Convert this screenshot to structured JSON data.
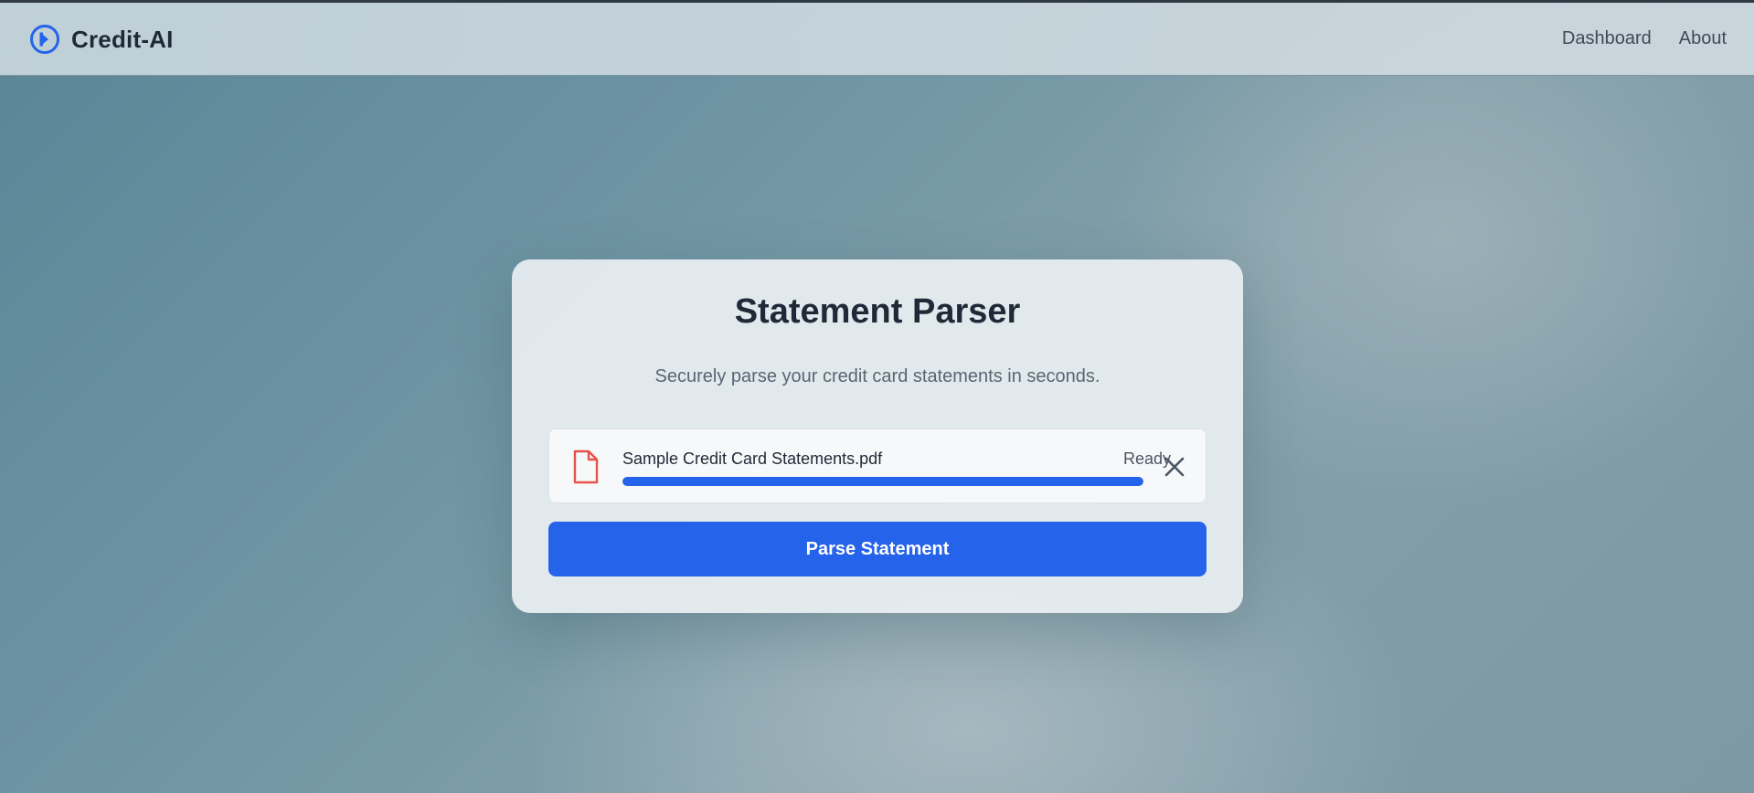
{
  "header": {
    "brand_name": "Credit-AI",
    "nav": [
      {
        "label": "Dashboard"
      },
      {
        "label": "About"
      }
    ]
  },
  "card": {
    "title": "Statement Parser",
    "subtitle": "Securely parse your credit card statements in seconds.",
    "file": {
      "name": "Sample Credit Card Statements.pdf",
      "status": "Ready",
      "progress": 1.0,
      "icon": "document-icon"
    },
    "parse_button_label": "Parse Statement"
  },
  "colors": {
    "accent": "#2563eb",
    "file_icon": "#e5534b",
    "title": "#1f2937"
  }
}
